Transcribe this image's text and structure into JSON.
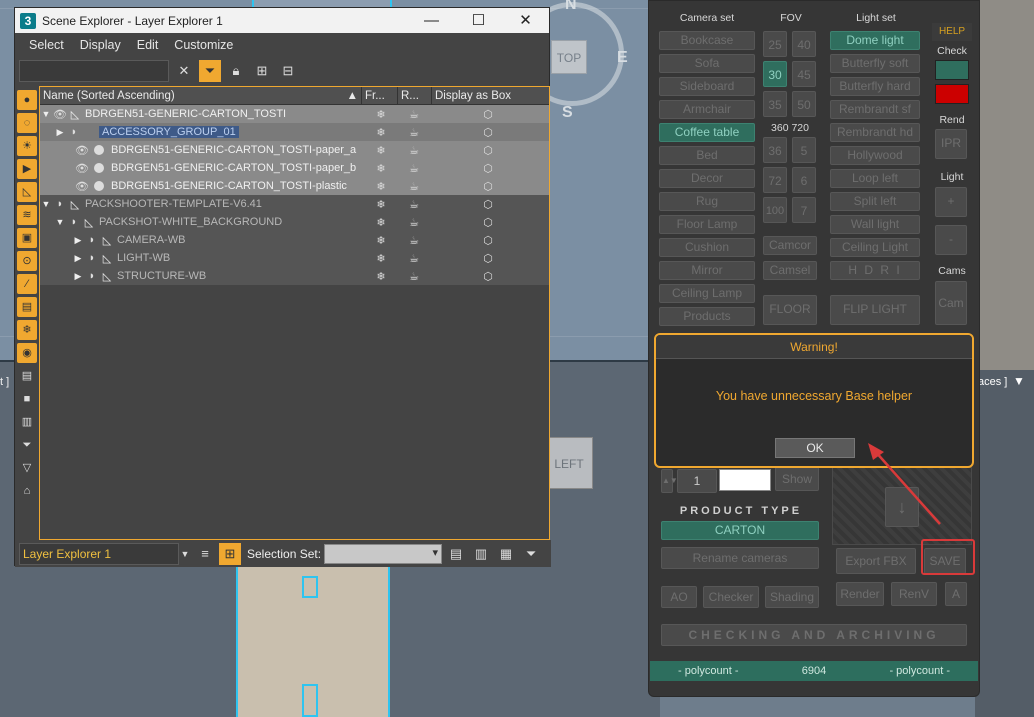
{
  "scene_explorer": {
    "window_title": "Scene Explorer - Layer Explorer 1",
    "logo": "3",
    "menu": [
      "Select",
      "Display",
      "Edit",
      "Customize"
    ],
    "columns": [
      "Name (Sorted Ascending)",
      "Fr...",
      "R...",
      "Display as Box"
    ],
    "rows": [
      {
        "label": "BDRGEN51-GENERIC-CARTON_TOSTI"
      },
      {
        "label": "ACCESSORY_GROUP_01"
      },
      {
        "label": "BDRGEN51-GENERIC-CARTON_TOSTI-paper_a"
      },
      {
        "label": "BDRGEN51-GENERIC-CARTON_TOSTI-paper_b"
      },
      {
        "label": "BDRGEN51-GENERIC-CARTON_TOSTI-plastic"
      },
      {
        "label": "PACKSHOOTER-TEMPLATE-V6.41"
      },
      {
        "label": "PACKSHOT-WHITE_BACKGROUND"
      },
      {
        "label": "CAMERA-WB"
      },
      {
        "label": "LIGHT-WB"
      },
      {
        "label": "STRUCTURE-WB"
      }
    ],
    "explorer_combo": "Layer Explorer 1",
    "selection_set_label": "Selection Set:"
  },
  "panel": {
    "headers": {
      "camera_set": "Camera set",
      "fov": "FOV",
      "light_set": "Light set",
      "help": "HELP",
      "check": "Check",
      "rend": "Rend",
      "light": "Light",
      "cams": "Cams",
      "fov_range": "360 720"
    },
    "camera_set": [
      "Bookcase",
      "Sofa",
      "Sideboard",
      "Armchair",
      "Coffee table",
      "Bed",
      "Decor",
      "Rug",
      "Floor Lamp",
      "Cushion",
      "Mirror",
      "Ceiling Lamp",
      "Products"
    ],
    "fov_a": [
      "25",
      "30",
      "35"
    ],
    "fov_b": [
      "40",
      "45",
      "50"
    ],
    "fov_c": [
      "36",
      "72",
      "100"
    ],
    "fov_d": [
      "5",
      "6",
      "7"
    ],
    "light_set": [
      "Dome light",
      "Butterfly soft",
      "Butterfly hard",
      "Rembrandt sf",
      "Rembrandt hd",
      "Hollywood",
      "Loop left",
      "Split left",
      "Wall light",
      "Ceiling Light",
      "H D R I"
    ],
    "cam_buttons": [
      "Camcor",
      "Camsel"
    ],
    "floor": "FLOOR",
    "flip_light": "FLIP LIGHT",
    "ipr": "IPR",
    "plus": "+",
    "minus": "-",
    "cam": "Cam",
    "spinner_value": "1",
    "show": "Show",
    "product_type_label": "PRODUCT TYPE",
    "product_type_value": "CARTON",
    "rename_cameras": "Rename cameras",
    "export_fbx": "Export FBX",
    "save": "SAVE",
    "ao": "AO",
    "checker": "Checker",
    "shading": "Shading",
    "render": "Render",
    "renv": "RenV",
    "a": "A",
    "checking_archiving": "CHECKING AND ARCHIVING",
    "polycount_left": "- polycount -",
    "polycount_value": "6904",
    "polycount_right": "- polycount -",
    "colors": {
      "teal": "#2f6e5e",
      "red": "#cc0000",
      "accent": "#f0a830"
    }
  },
  "warning": {
    "title": "Warning!",
    "message": "You have unnecessary Base helper",
    "ok": "OK"
  },
  "viewport": {
    "navcube_top": "TOP",
    "navcube_left": "LEFT",
    "compass_n": "N",
    "compass_e": "E",
    "compass_s": "S",
    "bracket_left": "t ]",
    "bracket_right": "aces ]"
  }
}
